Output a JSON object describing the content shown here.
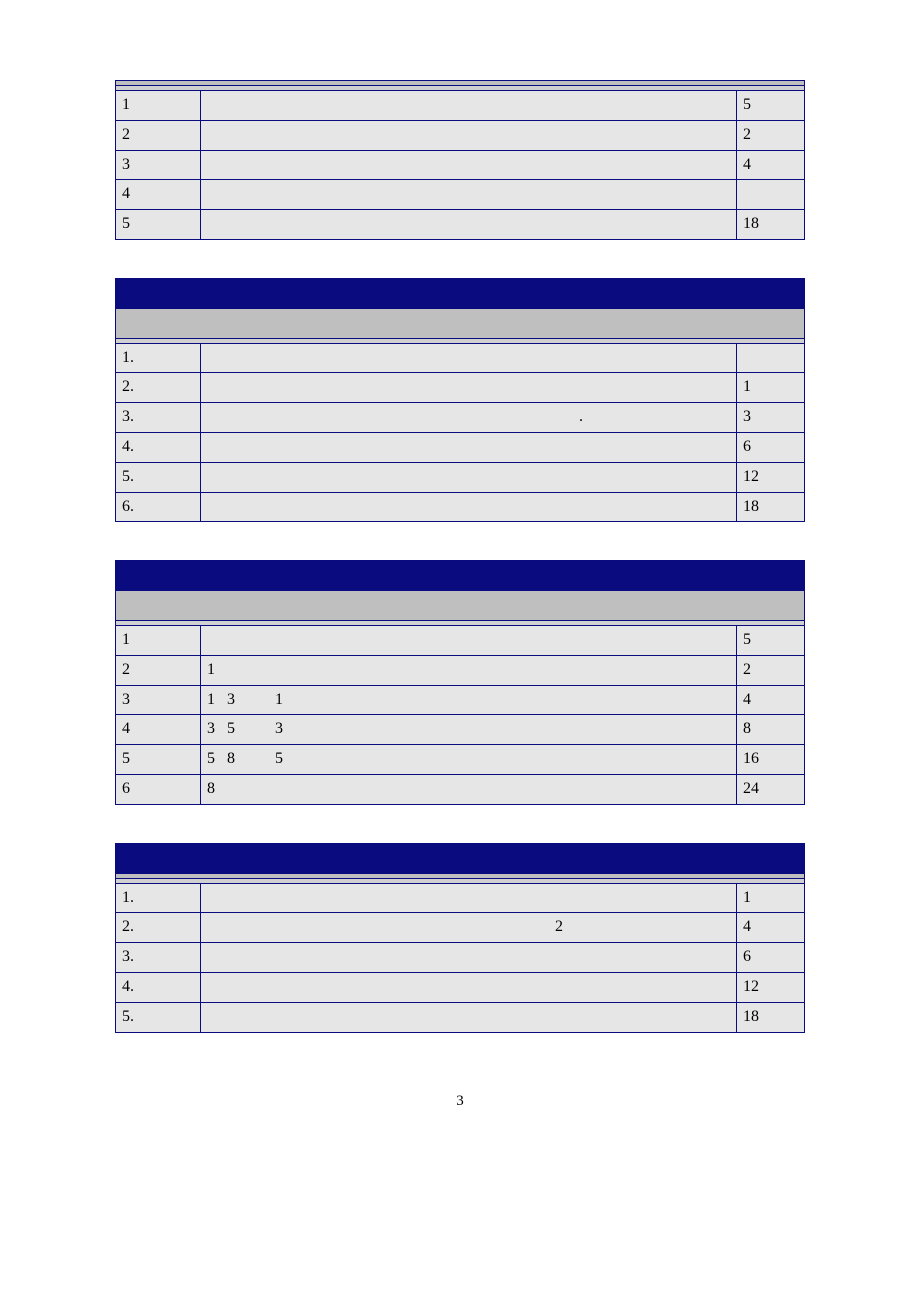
{
  "page_number": "3",
  "tables": [
    {
      "id": "t5",
      "navy": null,
      "header_grey": " ",
      "header_light": " ",
      "rows": [
        {
          "idx": "1",
          "content": " ",
          "pts": "5"
        },
        {
          "idx": "2",
          "content": " ",
          "pts": "2"
        },
        {
          "idx": "3",
          "content": " ",
          "pts": "4"
        },
        {
          "idx": "4",
          "content": "\n ",
          "pts": ""
        },
        {
          "idx": "5",
          "content": " ",
          "pts": "18"
        }
      ]
    },
    {
      "id": "t6",
      "navy": "6",
      "header_grey": "\n ",
      "header_light": " ",
      "rows": [
        {
          "idx": "1.",
          "content": " ",
          "pts": ""
        },
        {
          "idx": "2.",
          "content": " ",
          "pts": "1"
        },
        {
          "idx": "3.",
          "content": "                                                                                             .",
          "pts": "3"
        },
        {
          "idx": "4.",
          "content": " ",
          "pts": "6"
        },
        {
          "idx": "5.",
          "content": " ",
          "pts": "12"
        },
        {
          "idx": "6.",
          "content": " ",
          "pts": "18"
        }
      ]
    },
    {
      "id": "t7",
      "navy": "7",
      "header_grey": "\n ",
      "header_light": " ",
      "rows": [
        {
          "idx": "1",
          "content": " ",
          "pts": "5"
        },
        {
          "idx": "2",
          "content": "1",
          "pts": "2"
        },
        {
          "idx": "3",
          "content": "1   3          1",
          "pts": "4"
        },
        {
          "idx": "4",
          "content": "3   5          3",
          "pts": "8"
        },
        {
          "idx": "5",
          "content": "5   8          5",
          "pts": "16"
        },
        {
          "idx": "6",
          "content": "8",
          "pts": "24"
        }
      ]
    },
    {
      "id": "t8",
      "navy": "8",
      "header_grey": " ",
      "header_light": " ",
      "rows": [
        {
          "idx": "1.",
          "content": " ",
          "pts": "1"
        },
        {
          "idx": "2.",
          "content": "                                                                                       2",
          "pts": "4"
        },
        {
          "idx": "3.",
          "content": " ",
          "pts": "6"
        },
        {
          "idx": "4.",
          "content": " ",
          "pts": "12"
        },
        {
          "idx": "5.",
          "content": " ",
          "pts": "18"
        }
      ]
    }
  ]
}
